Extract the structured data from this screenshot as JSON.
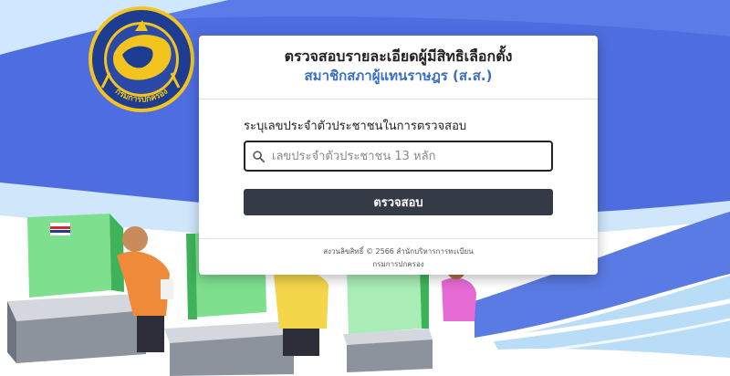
{
  "header": {
    "title_line1": "ตรวจสอบรายละเอียดผู้มีสิทธิเลือกตั้ง",
    "title_line2": "สมาชิกสภาผู้แทนราษฎร (ส.ส.)"
  },
  "form": {
    "label": "ระบุเลขประจำตัวประชาชนในการตรวจสอบ",
    "input_value": "",
    "input_placeholder": "เลขประจำตัวประชาชน 13 หลัก",
    "submit_label": "ตรวจสอบ"
  },
  "footer": {
    "copyright": "สงวนลิขสิทธิ์ © 2566 สำนักบริหารการทะเบียน",
    "department": "กรมการปกครอง"
  },
  "logo": {
    "ring_text": "กรมการปกครอง",
    "icon": "tiger-emblem-icon"
  },
  "colors": {
    "background_blue": "#4f6fe0",
    "accent_blue": "#3a6fc6",
    "button": "#343a46",
    "logo_gold": "#f2c41d"
  }
}
